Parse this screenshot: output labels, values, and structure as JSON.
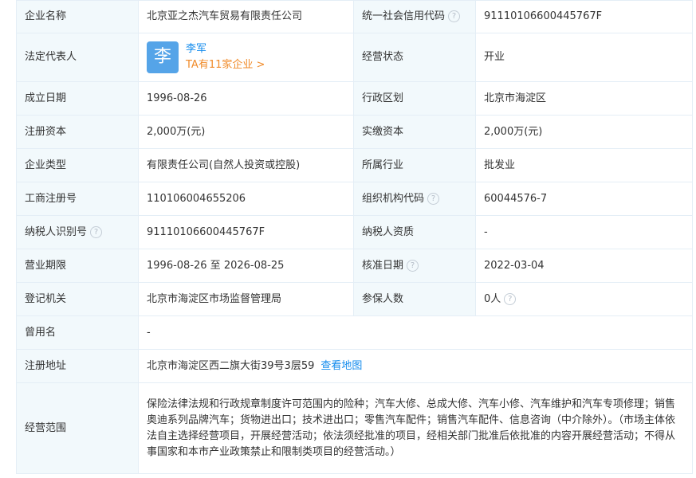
{
  "rows": [
    {
      "label": "企业名称",
      "value": "北京亚之杰汽车贸易有限责任公司",
      "label2": "统一社会信用代码",
      "value2": "91110106600445767F"
    },
    {
      "label": "法定代表人",
      "rep_avatar": "李",
      "rep_name": "李军",
      "rep_link": "TA有11家企业 >",
      "label2": "经营状态",
      "value2": "开业"
    },
    {
      "label": "成立日期",
      "value": "1996-08-26",
      "label2": "行政区划",
      "value2": "北京市海淀区"
    },
    {
      "label": "注册资本",
      "value": "2,000万(元)",
      "label2": "实缴资本",
      "value2": "2,000万(元)"
    },
    {
      "label": "企业类型",
      "value": "有限责任公司(自然人投资或控股)",
      "label2": "所属行业",
      "value2": "批发业"
    },
    {
      "label": "工商注册号",
      "value": "110106004655206",
      "label2": "组织机构代码",
      "value2": "60044576-7"
    },
    {
      "label": "纳税人识别号",
      "value": "91110106600445767F",
      "label2": "纳税人资质",
      "value2": "-"
    },
    {
      "label": "营业期限",
      "value": "1996-08-26 至 2026-08-25",
      "label2": "核准日期",
      "value2": "2022-03-04"
    },
    {
      "label": "登记机关",
      "value": "北京市海淀区市场监督管理局",
      "label2": "参保人数",
      "value2": "0人"
    },
    {
      "label": "曾用名",
      "value": "-"
    },
    {
      "label": "注册地址",
      "value": "北京市海淀区西二旗大街39号3层59",
      "link": "查看地图"
    },
    {
      "label": "经营范围",
      "value": "保险法律法规和行政规章制度许可范围内的险种；汽车大修、总成大修、汽车小修、汽车维护和汽车专项修理；销售奥迪系列品牌汽车；货物进出口；技术进出口；零售汽车配件；销售汽车配件、信息咨询（中介除外）。（市场主体依法自主选择经营项目，开展经营活动；依法须经批准的项目，经相关部门批准后依批准的内容开展经营活动；不得从事国家和本市产业政策禁止和限制类项目的经营活动。）"
    }
  ],
  "help_glyph": "?",
  "colors": {
    "label_bg": "#f2f9fc",
    "border": "#e4eef6",
    "link_blue": "#128bed",
    "link_orange": "#f08b2a",
    "avatar_bg": "#55a4e8"
  }
}
